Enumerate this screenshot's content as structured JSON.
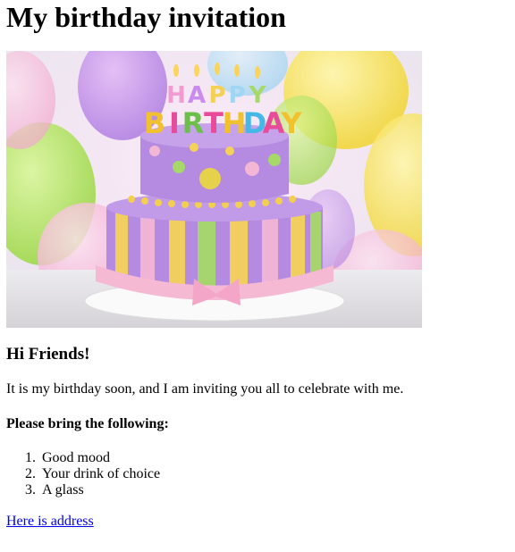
{
  "heading": "My birthday invitation",
  "image": {
    "alt": "Birthday cake",
    "candle_letters": [
      "H",
      "A",
      "P",
      "P",
      "Y"
    ],
    "candle_letters_2": [
      "B",
      "I",
      "R",
      "T",
      "H",
      "D",
      "A",
      "Y"
    ]
  },
  "greeting": "Hi Friends!",
  "intro": "It is my birthday soon, and I am inviting you all to celebrate with me.",
  "bring_heading": "Please bring the following:",
  "items": [
    {
      "num": "1.",
      "text": "Good mood"
    },
    {
      "num": "2.",
      "text": "Your drink of choice"
    },
    {
      "num": "3.",
      "text": "A glass"
    }
  ],
  "link": {
    "text": "Here is address"
  }
}
